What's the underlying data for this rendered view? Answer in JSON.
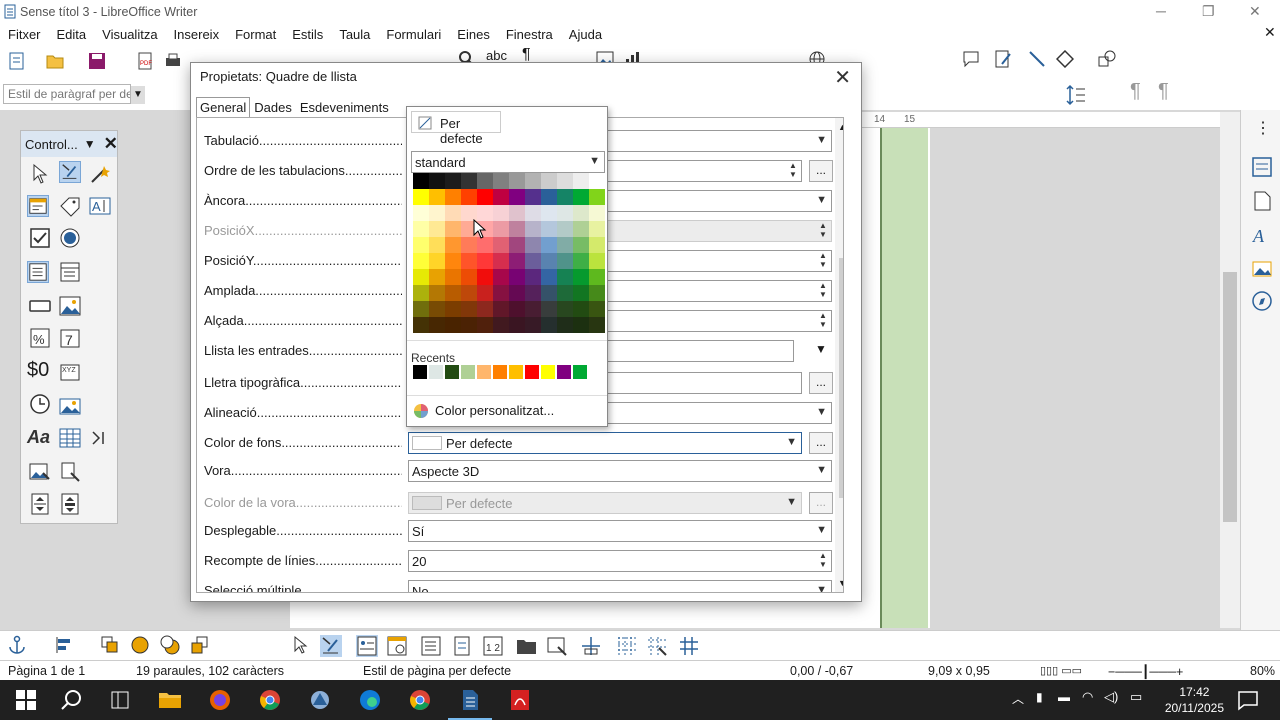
{
  "window": {
    "title": "Sense títol 3 - LibreOffice Writer"
  },
  "menu": [
    "Fitxer",
    "Edita",
    "Visualitza",
    "Insereix",
    "Format",
    "Estils",
    "Taula",
    "Formulari",
    "Eines",
    "Finestra",
    "Ajuda"
  ],
  "toolbar": {
    "paragraph_style_placeholder": "Estil de paràgraf per de"
  },
  "controls_toolbox": {
    "title": "Control..."
  },
  "ruler": {
    "tick_14": "14",
    "tick_15": "15"
  },
  "dialog": {
    "title": "Propietats: Quadre de llista",
    "tabs": [
      "General",
      "Dades",
      "Esdeveniments"
    ],
    "active_tab": "General",
    "properties": [
      {
        "label": "Tabulació..............................................................",
        "value": "",
        "disabled": false,
        "kind": "select"
      },
      {
        "label": "Ordre de les tabulacions.................................................",
        "value": "",
        "disabled": false,
        "kind": "spin-dots"
      },
      {
        "label": "Àncora..................................................................",
        "value": "",
        "disabled": false,
        "kind": "select"
      },
      {
        "label": "PosicióX................................................................",
        "value": "",
        "disabled": true,
        "kind": "spin"
      },
      {
        "label": "PosicióY................................................................",
        "value": "",
        "disabled": false,
        "kind": "spin"
      },
      {
        "label": "Amplada.................................................................",
        "value": "",
        "disabled": false,
        "kind": "spin"
      },
      {
        "label": "Alçada..................................................................",
        "value": "",
        "disabled": false,
        "kind": "spin"
      },
      {
        "label": "Llista les entrades.....................................................",
        "value": "",
        "disabled": false,
        "kind": "listdrop"
      },
      {
        "label": "Lletra tipogràfica......................................................",
        "value": "",
        "disabled": false,
        "kind": "dots"
      },
      {
        "label": "Alineació...............................................................",
        "value": "",
        "disabled": false,
        "kind": "select"
      },
      {
        "label": "Color de fons...........................................................",
        "value": "Per defecte",
        "disabled": false,
        "kind": "color"
      },
      {
        "label": "Vora....................................................................",
        "value": "Aspecte 3D",
        "disabled": false,
        "kind": "select"
      },
      {
        "label": "Color de la vora........................................................",
        "value": "Per defecte",
        "disabled": true,
        "kind": "color"
      },
      {
        "label": "Desplegable.............................................................",
        "value": "Sí",
        "disabled": false,
        "kind": "select"
      },
      {
        "label": "Recompte de línies......................................................",
        "value": "20",
        "disabled": false,
        "kind": "spin"
      },
      {
        "label": "Selecció múltiple.......................................................",
        "value": "No",
        "disabled": false,
        "kind": "select"
      }
    ]
  },
  "color_popup": {
    "default_label": "Per defecte",
    "palette": "standard",
    "recents_label": "Recents",
    "custom_label": "Color personalitzat...",
    "grid": [
      [
        "#000000",
        "#111111",
        "#1c1c1c",
        "#333333",
        "#666666",
        "#808080",
        "#999999",
        "#b2b2b2",
        "#cccccc",
        "#dddddd",
        "#eeeeee",
        "#ffffff"
      ],
      [
        "#ffff00",
        "#ffbf00",
        "#ff8000",
        "#ff4000",
        "#ff0000",
        "#bf0041",
        "#800080",
        "#55308d",
        "#2a6099",
        "#158466",
        "#00a933",
        "#81d41a"
      ],
      [
        "#ffffd7",
        "#fff5ce",
        "#ffdbb6",
        "#ffd8ce",
        "#ffd7d7",
        "#f7d1d5",
        "#e0c2cd",
        "#dedce6",
        "#dee6ef",
        "#dee7e5",
        "#dde8cb",
        "#f6f9d4"
      ],
      [
        "#ffffa6",
        "#ffe994",
        "#ffb66c",
        "#ffaa95",
        "#ffa6a6",
        "#ec9ba4",
        "#bf819e",
        "#b7b3ca",
        "#b4c7dc",
        "#b3cac7",
        "#afd095",
        "#e8f2a1"
      ],
      [
        "#ffff6d",
        "#ffde59",
        "#ff972f",
        "#ff7b59",
        "#ff6d6d",
        "#e16173",
        "#a1467e",
        "#8e86ae",
        "#729fcf",
        "#81aca6",
        "#77bc65",
        "#d4ea6b"
      ],
      [
        "#ffff38",
        "#ffd428",
        "#ff860d",
        "#ff5429",
        "#ff3838",
        "#d62e4e",
        "#8d1d75",
        "#6b5e9b",
        "#5983b0",
        "#50938a",
        "#3faf46",
        "#bbe33d"
      ],
      [
        "#e6e905",
        "#e8a202",
        "#ea7500",
        "#ed4c05",
        "#f10d0c",
        "#a7074b",
        "#780373",
        "#5b277d",
        "#3465a4",
        "#168253",
        "#069a2e",
        "#5eb91e"
      ],
      [
        "#acb20c",
        "#b47804",
        "#b85c00",
        "#be480a",
        "#c9211e",
        "#861141",
        "#650953",
        "#55215b",
        "#355269",
        "#1e6a39",
        "#127622",
        "#468a1a"
      ],
      [
        "#706e0c",
        "#784b04",
        "#7b3d00",
        "#813709",
        "#8d281e",
        "#611729",
        "#4e102d",
        "#481d32",
        "#383d3c",
        "#28471f",
        "#224b12",
        "#395511"
      ],
      [
        "#443205",
        "#472702",
        "#492300",
        "#4b2204",
        "#50200c",
        "#41191f",
        "#3a1522",
        "#371a26",
        "#252f2e",
        "#1f2d19",
        "#1c3010",
        "#283611"
      ]
    ],
    "recents": [
      "#000000",
      "#dee7e5",
      "#224b12",
      "#afd095",
      "#ffb66c",
      "#ff8000",
      "#ffbf00",
      "#ff0000",
      "#ffff00",
      "#800080",
      "#00a933"
    ]
  },
  "statusbar": {
    "page": "Pàgina 1 de 1",
    "words": "19 paraules, 102 caràcters",
    "page_style": "Estil de pàgina per defecte",
    "position": "0,00 / -0,67",
    "size": "9,09 x 0,95",
    "zoom": "80%"
  },
  "taskbar": {
    "time": "17:42",
    "date": "20/11/2025"
  }
}
